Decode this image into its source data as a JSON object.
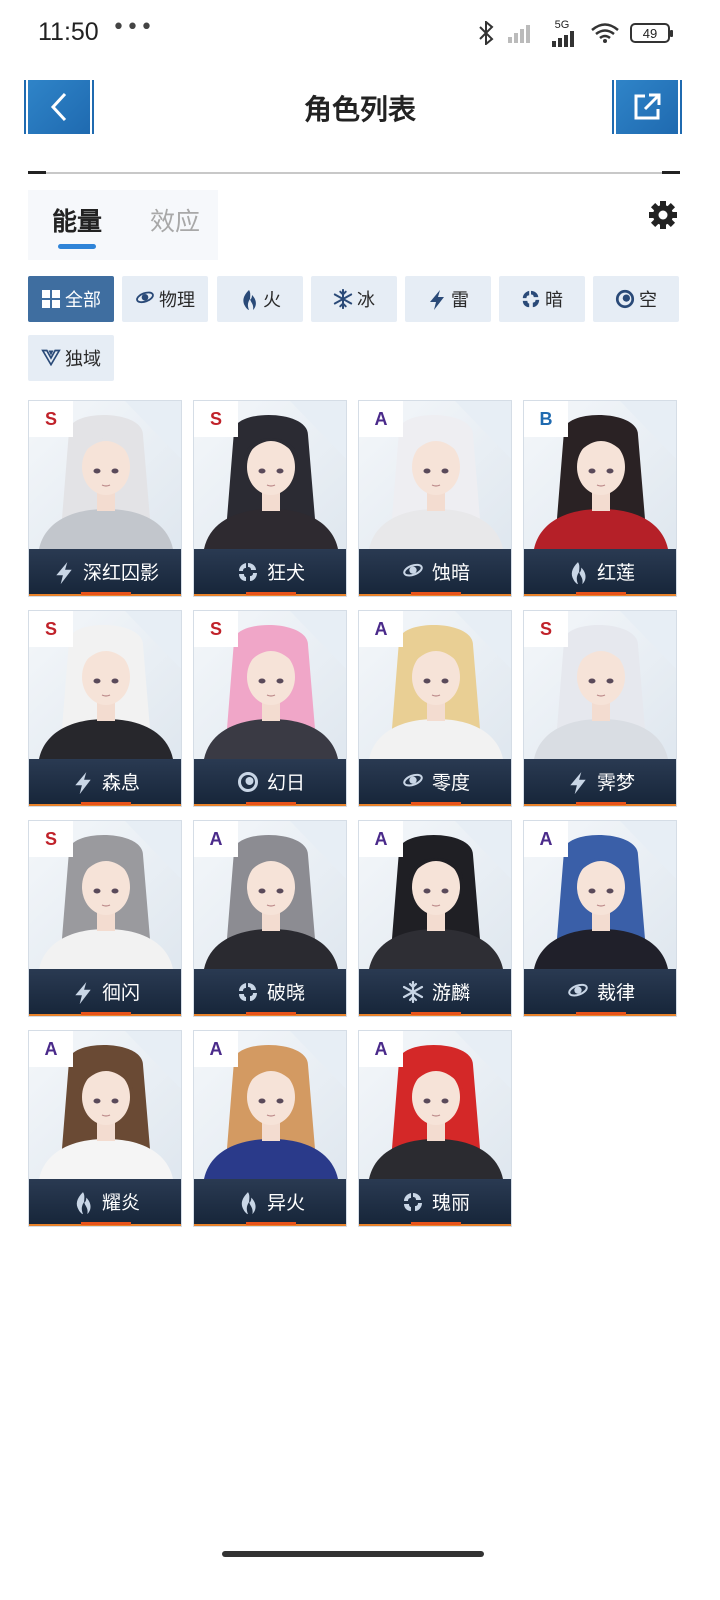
{
  "status": {
    "time": "11:50",
    "dots": "•••",
    "network": "5G",
    "battery": "49"
  },
  "header": {
    "title": "角色列表"
  },
  "tabs": {
    "energy": "能量",
    "effect": "效应"
  },
  "filters": [
    {
      "label": "全部",
      "icon": "grid-icon",
      "active": true
    },
    {
      "label": "物理",
      "icon": "physical-icon"
    },
    {
      "label": "火",
      "icon": "fire-icon"
    },
    {
      "label": "冰",
      "icon": "ice-icon"
    },
    {
      "label": "雷",
      "icon": "lightning-icon"
    },
    {
      "label": "暗",
      "icon": "dark-icon"
    },
    {
      "label": "空",
      "icon": "void-icon"
    },
    {
      "label": "独域",
      "icon": "domain-icon"
    }
  ],
  "characters": [
    {
      "rank": "S",
      "name": "深红囚影",
      "element": "lightning"
    },
    {
      "rank": "S",
      "name": "狂犬",
      "element": "dark"
    },
    {
      "rank": "A",
      "name": "蚀暗",
      "element": "physical"
    },
    {
      "rank": "B",
      "name": "红莲",
      "element": "fire"
    },
    {
      "rank": "S",
      "name": "森息",
      "element": "lightning"
    },
    {
      "rank": "S",
      "name": "幻日",
      "element": "void"
    },
    {
      "rank": "A",
      "name": "零度",
      "element": "physical"
    },
    {
      "rank": "S",
      "name": "霁梦",
      "element": "lightning"
    },
    {
      "rank": "S",
      "name": "徊闪",
      "element": "lightning"
    },
    {
      "rank": "A",
      "name": "破晓",
      "element": "dark"
    },
    {
      "rank": "A",
      "name": "游麟",
      "element": "ice"
    },
    {
      "rank": "A",
      "name": "裁律",
      "element": "physical"
    },
    {
      "rank": "A",
      "name": "耀炎",
      "element": "fire"
    },
    {
      "rank": "A",
      "name": "异火",
      "element": "fire"
    },
    {
      "rank": "A",
      "name": "瑰丽",
      "element": "dark"
    }
  ],
  "colors": {
    "accent_blue": "#2f84c8",
    "chip_active": "#3f6ea0",
    "chip_bg": "#e6edf5",
    "card_bar": "#1e2d44",
    "card_accent": "#e8822a",
    "rank_S": "#c0222a",
    "rank_A": "#4a2a8a",
    "rank_B": "#1f6ab0"
  }
}
